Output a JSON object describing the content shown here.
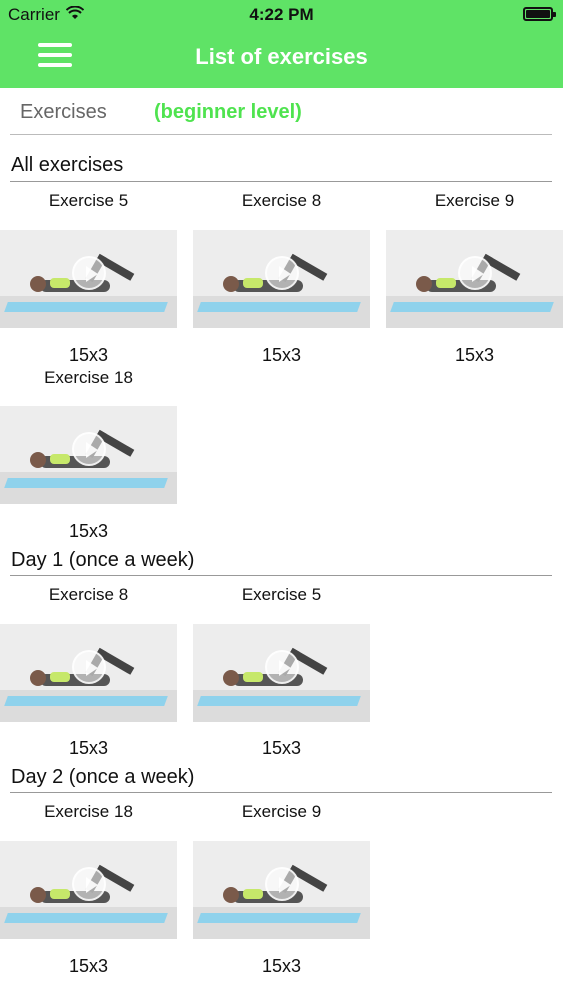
{
  "status_bar": {
    "carrier": "Carrier",
    "time": "4:22 PM"
  },
  "header": {
    "title": "List of exercises"
  },
  "tabs": {
    "exercises_label": "Exercises",
    "level_label": "(beginner level)"
  },
  "sections": [
    {
      "title": "All exercises",
      "cards": [
        {
          "name": "Exercise 5",
          "sets": "15x3"
        },
        {
          "name": "Exercise 8",
          "sets": "15x3"
        },
        {
          "name": "Exercise 9",
          "sets": "15x3"
        },
        {
          "name": "Exercise 18",
          "sets": "15x3"
        }
      ]
    },
    {
      "title": "Day 1 (once a week)",
      "cards": [
        {
          "name": "Exercise 8",
          "sets": "15x3"
        },
        {
          "name": "Exercise 5",
          "sets": "15x3"
        }
      ]
    },
    {
      "title": "Day 2 (once a week)",
      "cards": [
        {
          "name": "Exercise 18",
          "sets": "15x3"
        },
        {
          "name": "Exercise 9",
          "sets": "15x3"
        }
      ]
    }
  ],
  "colors": {
    "accent": "#5fe366",
    "level_text": "#4fe34f"
  }
}
